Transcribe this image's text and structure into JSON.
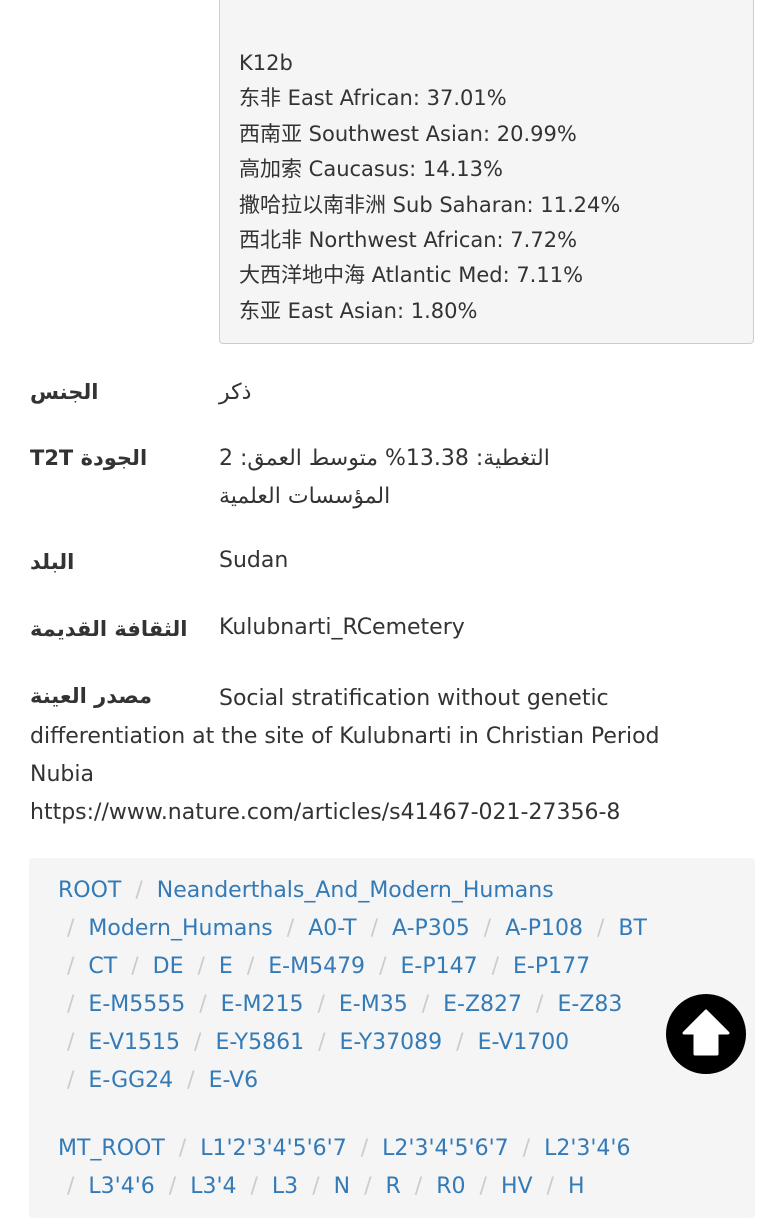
{
  "k12b": {
    "title": "K12b",
    "lines": [
      "东非 East African: 37.01%",
      "西南亚 Southwest Asian: 20.99%",
      "高加索 Caucasus: 14.13%",
      "撒哈拉以南非洲 Sub Saharan: 11.24%",
      "西北非 Northwest African: 7.72%",
      "大西洋地中海 Atlantic Med: 7.11%",
      "东亚 East Asian: 1.80%"
    ]
  },
  "fields": {
    "gender_label": "الجنس",
    "gender_value": "ذكر",
    "quality_label": "T2T الجودة",
    "quality_line1": "التغطية: 13.38% متوسط العمق: 2",
    "quality_line2": "المؤسسات العلمية",
    "country_label": "البلد",
    "country_value": "Sudan",
    "culture_label": "الثقافة القديمة",
    "culture_value": "Kulubnarti_RCemetery",
    "source_label": "مصدر العينة",
    "source_text": "Social stratification without genetic differentiation at the site of Kulubnarti in Christian Period Nubia",
    "source_url": "https://www.nature.com/articles/s41467-021-27356-8"
  },
  "y_tree": [
    [
      "ROOT",
      "Neanderthals_And_Modern_Humans"
    ],
    [
      "Modern_Humans",
      "A0-T",
      "A-P305",
      "A-P108",
      "BT"
    ],
    [
      "CT",
      "DE",
      "E",
      "E-M5479",
      "E-P147",
      "E-P177"
    ],
    [
      "E-M5555",
      "E-M215",
      "E-M35",
      "E-Z827",
      "E-Z83"
    ],
    [
      "E-V1515",
      "E-Y5861",
      "E-Y37089",
      "E-V1700"
    ],
    [
      "E-GG24",
      "E-V6"
    ]
  ],
  "mt_tree": [
    [
      "MT_ROOT",
      "L1'2'3'4'5'6'7",
      "L2'3'4'5'6'7",
      "L2'3'4'6"
    ],
    [
      "L3'4'6",
      "L3'4",
      "L3",
      "N",
      "R",
      "R0",
      "HV",
      "H"
    ]
  ],
  "colors": {
    "link": "#337ab7",
    "separator": "#cccccc",
    "panel": "#f5f5f5",
    "text": "#333333"
  },
  "icons": {
    "scroll_top": "arrow-up-circle-icon"
  }
}
